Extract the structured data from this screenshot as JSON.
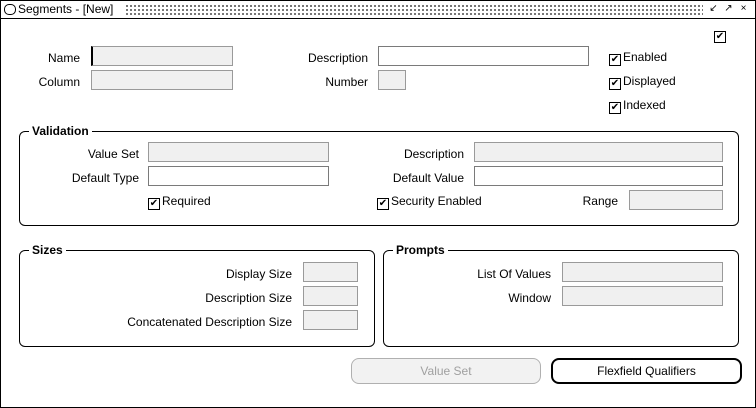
{
  "window": {
    "title": "Segments - [New]",
    "controls": [
      "↙",
      "↗",
      "×"
    ]
  },
  "form": {
    "name_label": "Name",
    "column_label": "Column",
    "description_label": "Description",
    "number_label": "Number",
    "checks": {
      "enabled": "Enabled",
      "displayed": "Displayed",
      "indexed": "Indexed"
    }
  },
  "validation": {
    "title": "Validation",
    "value_set_label": "Value Set",
    "default_type_label": "Default Type",
    "description_label": "Description",
    "default_value_label": "Default Value",
    "required_label": "Required",
    "security_label": "Security Enabled",
    "range_label": "Range"
  },
  "sizes": {
    "title": "Sizes",
    "display_size_label": "Display Size",
    "description_size_label": "Description Size",
    "concat_size_label": "Concatenated Description Size"
  },
  "prompts": {
    "title": "Prompts",
    "lov_label": "List Of Values",
    "window_label": "Window"
  },
  "buttons": {
    "value_set": "Value Set",
    "flexfield_qualifiers": "Flexfield Qualifiers"
  },
  "check_glyph": "✔"
}
